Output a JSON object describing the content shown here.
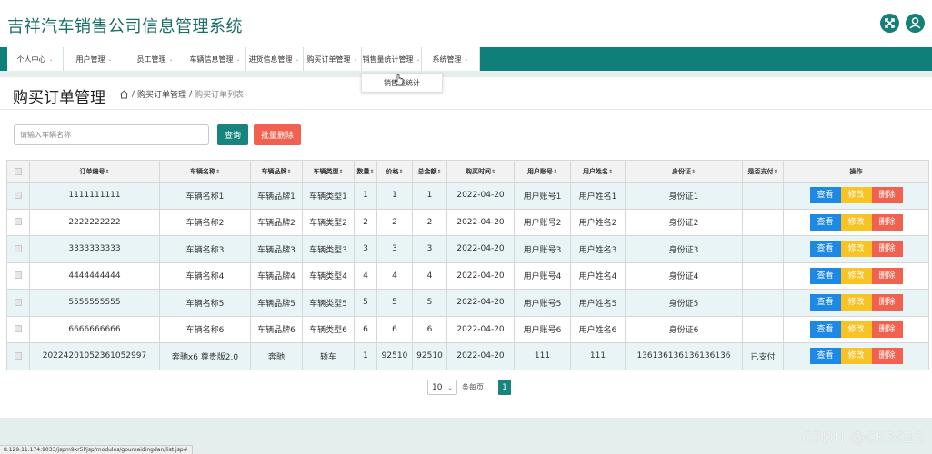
{
  "app": {
    "title": "吉祥汽车销售公司信息管理系统"
  },
  "header_icons": [
    "expand-icon",
    "user-icon"
  ],
  "nav": [
    {
      "label": "个人中心",
      "caret": "⌄"
    },
    {
      "label": "用户管理",
      "caret": "⌄"
    },
    {
      "label": "员工管理",
      "caret": "⌄"
    },
    {
      "label": "车辆信息管理",
      "caret": "⌄"
    },
    {
      "label": "进货信息管理",
      "caret": "⌄"
    },
    {
      "label": "购买订单管理",
      "caret": "⌄"
    },
    {
      "label": "销售量统计管理",
      "caret": "⌄"
    },
    {
      "label": "系统管理",
      "caret": "⌄"
    }
  ],
  "dropdown": {
    "item": "销售量统计"
  },
  "page": {
    "title": "购买订单管理",
    "breadcrumb": {
      "sep": "/",
      "section": "购买订单管理",
      "current": "购买订单列表"
    }
  },
  "search": {
    "placeholder": "请输入车辆名称",
    "value": "",
    "query_label": "查询",
    "batch_delete_label": "批量删除"
  },
  "table": {
    "sort_mark": "⇕",
    "columns": [
      "订单编号",
      "车辆名称",
      "车辆品牌",
      "车辆类型",
      "数量",
      "价格",
      "总金额",
      "购买时间",
      "用户账号",
      "用户姓名",
      "身份证",
      "是否支付",
      "操作"
    ],
    "rows": [
      [
        "1111111111",
        "车辆名称1",
        "车辆品牌1",
        "车辆类型1",
        "1",
        "1",
        "1",
        "2022-04-20",
        "用户账号1",
        "用户姓名1",
        "身份证1",
        ""
      ],
      [
        "2222222222",
        "车辆名称2",
        "车辆品牌2",
        "车辆类型2",
        "2",
        "2",
        "2",
        "2022-04-20",
        "用户账号2",
        "用户姓名2",
        "身份证2",
        ""
      ],
      [
        "3333333333",
        "车辆名称3",
        "车辆品牌3",
        "车辆类型3",
        "3",
        "3",
        "3",
        "2022-04-20",
        "用户账号3",
        "用户姓名3",
        "身份证3",
        ""
      ],
      [
        "4444444444",
        "车辆名称4",
        "车辆品牌4",
        "车辆类型4",
        "4",
        "4",
        "4",
        "2022-04-20",
        "用户账号4",
        "用户姓名4",
        "身份证4",
        ""
      ],
      [
        "5555555555",
        "车辆名称5",
        "车辆品牌5",
        "车辆类型5",
        "5",
        "5",
        "5",
        "2022-04-20",
        "用户账号5",
        "用户姓名5",
        "身份证5",
        ""
      ],
      [
        "6666666666",
        "车辆名称6",
        "车辆品牌6",
        "车辆类型6",
        "6",
        "6",
        "6",
        "2022-04-20",
        "用户账号6",
        "用户姓名6",
        "身份证6",
        ""
      ],
      [
        "20224201052361052997",
        "奔驰x6 尊贵版2.0",
        "奔驰",
        "轿车",
        "1",
        "92510",
        "92510",
        "2022-04-20",
        "111",
        "111",
        "136136136136136136",
        "已支付"
      ]
    ],
    "actions": {
      "view": "查看",
      "edit": "修改",
      "delete": "删除"
    }
  },
  "pager": {
    "page_size": "10",
    "per_page_label": "条每页",
    "current_page": "1"
  },
  "status_url": "8.129.11.174:9033/jspm9xr5l/jsp/modules/goumaidingdan/list.jsp#",
  "watermark": "CSDN @CK3012",
  "colors": {
    "primary": "#17847e",
    "danger": "#f0614f",
    "view": "#1e88e5",
    "edit": "#f7c325",
    "row_stripe": "#e8f4f6"
  }
}
